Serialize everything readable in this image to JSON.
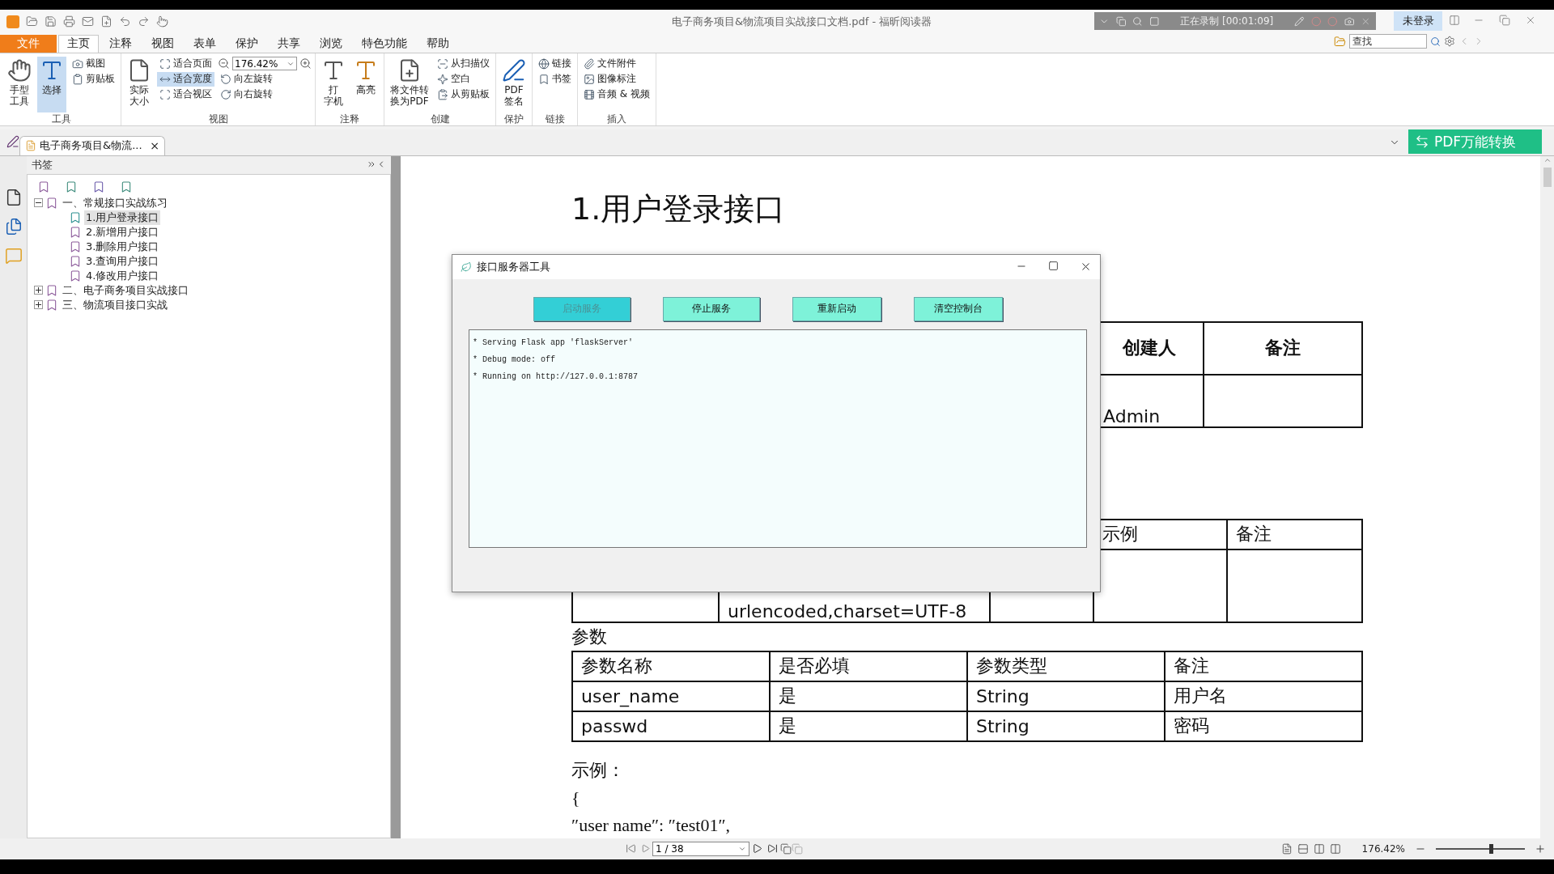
{
  "title_bar": {
    "title": "电子商务项目&物流项目实战接口文档.pdf - 福昕阅读器",
    "recording": "正在录制 [00:01:09]",
    "login": "未登录"
  },
  "menu_tabs": [
    {
      "label": "文件",
      "kind": "file",
      "selected": false
    },
    {
      "label": "主页",
      "kind": "tab",
      "selected": true
    },
    {
      "label": "注释",
      "kind": "tab",
      "selected": false
    },
    {
      "label": "视图",
      "kind": "tab",
      "selected": false
    },
    {
      "label": "表单",
      "kind": "tab",
      "selected": false
    },
    {
      "label": "保护",
      "kind": "tab",
      "selected": false
    },
    {
      "label": "共享",
      "kind": "tab",
      "selected": false
    },
    {
      "label": "浏览",
      "kind": "tab",
      "selected": false
    },
    {
      "label": "特色功能",
      "kind": "tab",
      "selected": false
    },
    {
      "label": "帮助",
      "kind": "tab",
      "selected": false
    }
  ],
  "search": {
    "placeholder": "查找"
  },
  "ribbon": [
    {
      "label": "工具",
      "columns": [
        {
          "kind": "large",
          "lines": [
            "手型",
            "工具"
          ],
          "selected": false
        },
        {
          "kind": "large",
          "lines": [
            "选择"
          ],
          "selected": true
        },
        {
          "kind": "stack",
          "items": [
            {
              "kind": "button",
              "label": "截图",
              "selected": false
            },
            {
              "kind": "button",
              "label": "剪贴板",
              "selected": false
            }
          ]
        }
      ]
    },
    {
      "label": "视图",
      "columns": [
        {
          "kind": "large",
          "lines": [
            "实际",
            "大小"
          ],
          "selected": false
        },
        {
          "kind": "stack",
          "items": [
            {
              "kind": "button",
              "label": "适合页面",
              "selected": false
            },
            {
              "kind": "button",
              "label": "适合宽度",
              "selected": true
            },
            {
              "kind": "button",
              "label": "适合视区",
              "selected": false
            }
          ]
        },
        {
          "kind": "stack",
          "items": [
            {
              "kind": "zoom",
              "value": "176.42%"
            },
            {
              "kind": "button",
              "label": "向左旋转",
              "selected": false
            },
            {
              "kind": "button",
              "label": "向右旋转",
              "selected": false
            }
          ]
        }
      ]
    },
    {
      "label": "注释",
      "columns": [
        {
          "kind": "large",
          "lines": [
            "打",
            "字机"
          ],
          "selected": false
        },
        {
          "kind": "large",
          "lines": [
            "高亮"
          ],
          "selected": false
        }
      ]
    },
    {
      "label": "创建",
      "columns": [
        {
          "kind": "large",
          "lines": [
            "将文件转",
            "换为PDF"
          ],
          "selected": false
        },
        {
          "kind": "stack",
          "items": [
            {
              "kind": "button",
              "label": "从扫描仪",
              "selected": false
            },
            {
              "kind": "button",
              "label": "空白",
              "selected": false
            },
            {
              "kind": "button",
              "label": "从剪贴板",
              "selected": false
            }
          ]
        }
      ]
    },
    {
      "label": "保护",
      "columns": [
        {
          "kind": "large",
          "lines": [
            "PDF",
            "签名"
          ],
          "selected": false
        }
      ]
    },
    {
      "label": "链接",
      "columns": [
        {
          "kind": "stack",
          "items": [
            {
              "kind": "button",
              "label": "链接",
              "selected": false
            },
            {
              "kind": "button",
              "label": "书签",
              "selected": false
            }
          ]
        }
      ]
    },
    {
      "label": "插入",
      "columns": [
        {
          "kind": "stack",
          "items": [
            {
              "kind": "button",
              "label": "文件附件",
              "selected": false
            },
            {
              "kind": "button",
              "label": "图像标注",
              "selected": false
            },
            {
              "kind": "button",
              "label": "音频 & 视频",
              "selected": false
            }
          ]
        }
      ]
    }
  ],
  "doc_tab": {
    "title": "电子商务项目&物流...",
    "close": "×"
  },
  "convert_button": "PDF万能转换",
  "sidebar": {
    "title": "书签",
    "tree": [
      {
        "label": "一、常规接口实战练习",
        "expanded": true,
        "selected": false,
        "children": [
          {
            "label": "1.用户登录接口",
            "selected": true
          },
          {
            "label": "2.新增用户接口",
            "selected": false
          },
          {
            "label": "3.删除用户接口",
            "selected": false
          },
          {
            "label": "3.查询用户接口",
            "selected": false
          },
          {
            "label": "4.修改用户接口",
            "selected": false
          }
        ]
      },
      {
        "label": "二、电子商务项目实战接口",
        "expanded": false,
        "selected": false
      },
      {
        "label": "三、物流项目接口实战",
        "expanded": false,
        "selected": false
      }
    ]
  },
  "document": {
    "heading": "1.用户登录接口",
    "table_1": {
      "columns": [
        "创建人",
        "备注"
      ],
      "cell": "Admin"
    },
    "table_2": {
      "columns": [
        "示例",
        "备注"
      ],
      "cell": "urlencoded,charset=UTF-8"
    },
    "params_label": "参数",
    "params_table": {
      "columns": [
        "参数名称",
        "是否必填",
        "参数类型",
        "备注"
      ],
      "rows": [
        [
          "user_name",
          "是",
          "String",
          "用户名"
        ],
        [
          "passwd",
          "是",
          "String",
          "密码"
        ]
      ]
    },
    "example_label": "示例：",
    "example_lines": [
      "{",
      "″user name″: ″test01″,"
    ]
  },
  "dialog": {
    "title": "接口服务器工具",
    "buttons": [
      {
        "label": "启动服务",
        "disabled": true
      },
      {
        "label": "停止服务",
        "disabled": false
      },
      {
        "label": "重新启动",
        "disabled": false
      },
      {
        "label": "清空控制台",
        "disabled": false
      }
    ],
    "console": [
      "* Serving Flask app 'flaskServer'",
      "* Debug mode: off",
      "* Running on http://127.0.0.1:8787"
    ]
  },
  "status_bar": {
    "page": "1 / 38",
    "zoom": "176.42%",
    "zoom_level": {
      "level": 0.62
    }
  }
}
